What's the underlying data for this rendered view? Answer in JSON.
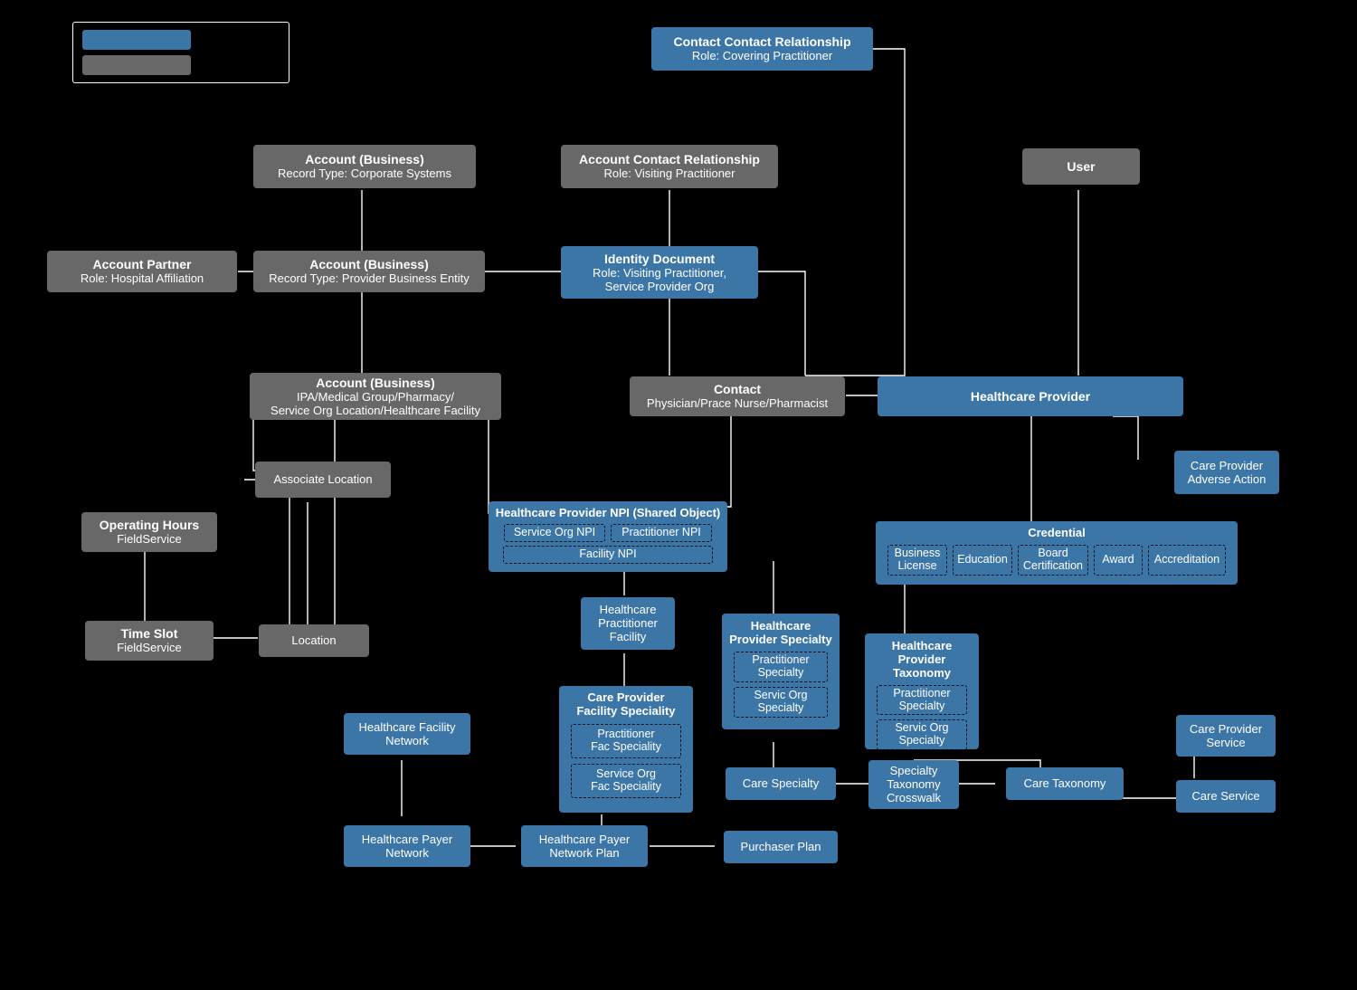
{
  "legend": {
    "colors": {
      "blue": "#3c76a6",
      "gray": "#686868"
    }
  },
  "ccr": {
    "title": "Contact Contact Relationship",
    "sub": "Role: Covering Practitioner"
  },
  "ab1": {
    "title": "Account (Business)",
    "sub": "Record Type: Corporate Systems"
  },
  "acr": {
    "title": "Account Contact Relationship",
    "sub": "Role: Visiting Practitioner"
  },
  "user": {
    "title": "User"
  },
  "ap": {
    "title": "Account Partner",
    "sub": "Role: Hospital Affiliation"
  },
  "ab2": {
    "title": "Account (Business)",
    "sub": "Record Type: Provider Business Entity"
  },
  "idoc": {
    "title": "Identity Document",
    "sub": "Role: Visiting Practitioner,\nService Provider Org"
  },
  "ab3": {
    "title": "Account (Business)",
    "sub": "IPA/Medical Group/Pharmacy/\nService Org Location/Healthcare Facility"
  },
  "contact": {
    "title": "Contact",
    "sub": "Physician/Prace Nurse/Pharmacist"
  },
  "hp": {
    "title": "Healthcare Provider"
  },
  "aloc": {
    "title": "Associate Location"
  },
  "cpaa": {
    "title": "Care Provider\nAdverse Action"
  },
  "oh": {
    "title": "Operating Hours",
    "sub": "FieldService"
  },
  "npi": {
    "title": "Healthcare Provider NPI (Shared Object)",
    "c1": "Service Org NPI",
    "c2": "Practitioner NPI",
    "c3": "Facility NPI"
  },
  "cred": {
    "title": "Credential",
    "c1": "Business\nLicense",
    "c2": "Education",
    "c3": "Board\nCertification",
    "c4": "Award",
    "c5": "Accreditation"
  },
  "ts": {
    "title": "Time Slot",
    "sub": "FieldService"
  },
  "loc": {
    "title": "Location"
  },
  "hpf": {
    "title": "Healthcare\nPractitioner\nFacility"
  },
  "hps": {
    "title": "Healthcare\nProvider Specialty",
    "c1": "Practitioner\nSpecialty",
    "c2": "Servic Org\nSpecialty"
  },
  "hpt": {
    "title": "Healthcare\nProvider Taxonomy",
    "c1": "Practitioner\nSpecialty",
    "c2": "Servic Org\nSpecialty"
  },
  "hfn": {
    "title": "Healthcare Facility\nNetwork"
  },
  "cpfs": {
    "title": "Care Provider\nFacility Speciality",
    "c1": "Practitioner\nFac Speciality",
    "c2": "Service Org\nFac Speciality"
  },
  "cps": {
    "title": "Care Provider\nService"
  },
  "cspec": {
    "title": "Care Specialty"
  },
  "stc": {
    "title": "Specialty\nTaxonomy\nCrosswalk"
  },
  "ctax": {
    "title": "Care Taxonomy"
  },
  "cserv": {
    "title": "Care Service"
  },
  "hpn": {
    "title": "Healthcare Payer\nNetwork"
  },
  "hpnp": {
    "title": "Healthcare Payer\nNetwork Plan"
  },
  "pp": {
    "title": "Purchaser Plan"
  }
}
